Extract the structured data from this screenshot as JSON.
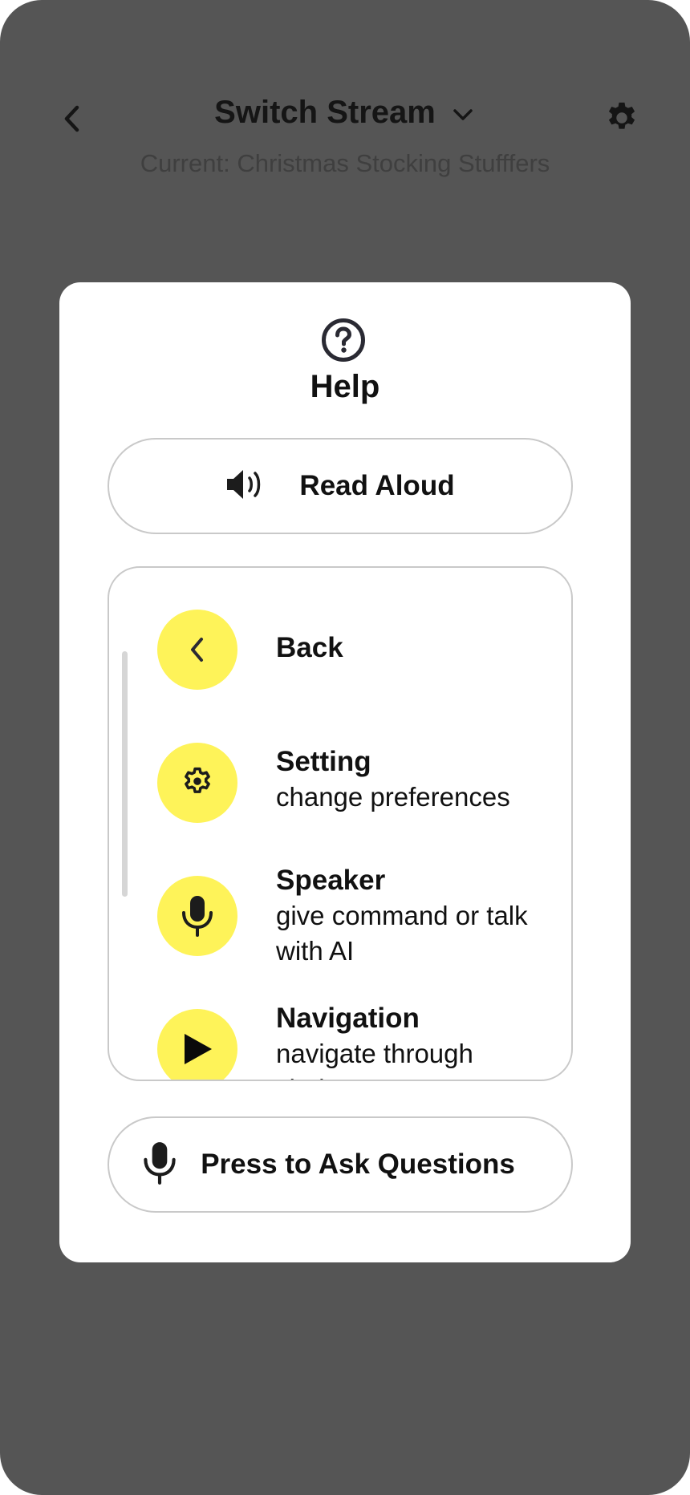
{
  "header": {
    "title": "Switch Stream",
    "current": "Current: Christmas Stocking Stufffers",
    "back_icon": "chevron-left-icon",
    "dropdown_icon": "chevron-down-icon",
    "settings_icon": "gear-icon"
  },
  "help": {
    "title": "Help",
    "icon": "question-circle-icon",
    "read_aloud_label": "Read Aloud",
    "ask_label": "Press to Ask Questions",
    "items": [
      {
        "title": "Back",
        "desc": "",
        "icon": "chevron-left-icon"
      },
      {
        "title": "Setting",
        "desc": "change preferences",
        "icon": "gear-icon"
      },
      {
        "title": "Speaker",
        "desc": "give command or talk with AI",
        "icon": "microphone-icon"
      },
      {
        "title": "Navigation",
        "desc": "navigate through choices",
        "icon": "play-icon"
      }
    ]
  },
  "colors": {
    "backdrop": "#555555",
    "accent_yellow": "#fef359",
    "border": "#c9c9c9"
  }
}
